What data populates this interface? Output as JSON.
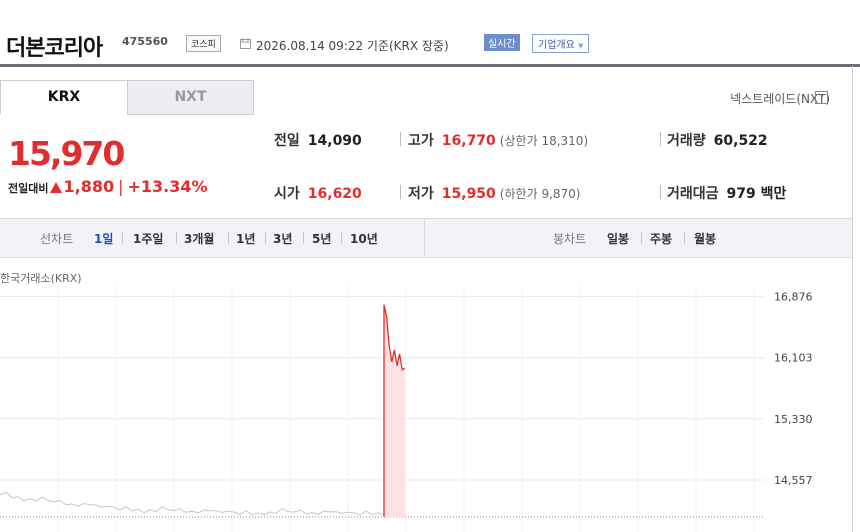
{
  "header": {
    "company_name": "더본코리아",
    "stock_code": "475560",
    "market": "코스피",
    "as_of": "2026.08.14 09:22  기준(KRX 장중)",
    "realtime_badge": "실시간",
    "overview_button": "기업개요"
  },
  "tabs": [
    {
      "label": "KRX",
      "active": true
    },
    {
      "label": "NXT",
      "active": false
    }
  ],
  "nxt_link": "넥스트레이드(NXT)",
  "price": {
    "current": "15,970",
    "change_label": "전일대비",
    "change": "1,880",
    "change_pct": "+13.34%",
    "direction": "up"
  },
  "stats": {
    "prev_close": {
      "label": "전일",
      "value": "14,090"
    },
    "high": {
      "label": "고가",
      "value": "16,770",
      "limit_label": "상한가",
      "limit_value": "18,310"
    },
    "volume": {
      "label": "거래량",
      "value": "60,522"
    },
    "open": {
      "label": "시가",
      "value": "16,620"
    },
    "low": {
      "label": "저가",
      "value": "15,950",
      "limit_label": "하한가",
      "limit_value": "9,870"
    },
    "trade_value": {
      "label": "거래대금",
      "value": "979 백만"
    }
  },
  "period_bar": {
    "line_chart_label": "선차트",
    "line_periods": [
      "1일",
      "1주일",
      "3개월",
      "1년",
      "3년",
      "5년",
      "10년"
    ],
    "active_period": "1일",
    "candle_label": "봉차트",
    "candle_periods": [
      "일봉",
      "주봉",
      "월봉"
    ]
  },
  "chart_source": "한국거래소(KRX)",
  "colors": {
    "up": "#e12d2d",
    "active": "#1c4fc7",
    "area": "#fde2e4"
  },
  "chart_data": {
    "type": "line",
    "title": "",
    "xlabel": "",
    "ylabel": "",
    "y_ticks": [
      16876,
      16103,
      15330,
      14557
    ],
    "ylim": [
      13900,
      17020
    ],
    "series": [
      {
        "name": "",
        "values": [
          16770,
          16620,
          16250,
          16050,
          16200,
          16000,
          16150,
          15950,
          15970
        ]
      }
    ],
    "prev_close_reference": 14090
  }
}
